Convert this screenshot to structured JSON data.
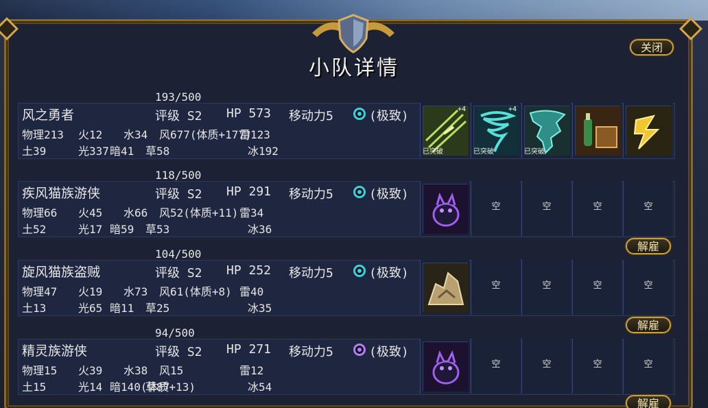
{
  "title": "小队详情",
  "close_label": "关闭",
  "release_label": "解雇",
  "empty_label": "空",
  "broken_label": "已突破",
  "plus_label": "+4",
  "colors": {
    "swirl_teal": "#3ed0d6",
    "swirl_purple": "#b37cf0"
  },
  "units": [
    {
      "count": "193/500",
      "name": "风之勇者",
      "rating": "评级 S2",
      "hp": "HP 573",
      "move": "移动力5",
      "level": "(极致)",
      "swirl": "teal",
      "row1": [
        "物理213",
        "火12",
        "水34",
        "风677(体质+177)",
        "雷123"
      ],
      "row2": [
        "土39",
        "光337",
        "暗41",
        "草58",
        "冰192"
      ],
      "slots": [
        {
          "icon": "claw-skill-icon",
          "plus": true,
          "broken": true
        },
        {
          "icon": "tornado-skill-icon",
          "plus": true,
          "broken": true
        },
        {
          "icon": "storm-skill-icon",
          "plus": false,
          "broken": true
        },
        {
          "icon": "potion-chest-icon",
          "plus": false,
          "broken": false
        },
        {
          "icon": "lightning-runner-icon",
          "plus": false,
          "broken": false
        }
      ]
    },
    {
      "count": "118/500",
      "name": "疾风猫族游侠",
      "rating": "评级 S2",
      "hp": "HP 291",
      "move": "移动力5",
      "level": "(极致)",
      "swirl": "teal",
      "row1": [
        "物理66",
        "火45",
        "水66",
        "风52(体质+11)",
        "雷34"
      ],
      "row2": [
        "土52",
        "光17",
        "暗59",
        "草53",
        "冰36"
      ],
      "slots": [
        {
          "icon": "shadow-cat-icon"
        },
        {
          "icon": "empty"
        },
        {
          "icon": "empty"
        },
        {
          "icon": "empty"
        },
        {
          "icon": "empty"
        }
      ]
    },
    {
      "count": "104/500",
      "name": "旋风猫族盗贼",
      "rating": "评级 S2",
      "hp": "HP 252",
      "move": "移动力5",
      "level": "(极致)",
      "swirl": "teal",
      "row1": [
        "物理47",
        "火19",
        "水73",
        "风61(体质+8)",
        "雷40"
      ],
      "row2": [
        "土13",
        "光65",
        "暗11",
        "草25",
        "冰35"
      ],
      "slots": [
        {
          "icon": "rock-pile-icon"
        },
        {
          "icon": "empty"
        },
        {
          "icon": "empty"
        },
        {
          "icon": "empty"
        },
        {
          "icon": "empty"
        }
      ]
    },
    {
      "count": "94/500",
      "name": "精灵族游侠",
      "rating": "评级 S2",
      "hp": "HP 271",
      "move": "移动力5",
      "level": "(极致)",
      "swirl": "purple",
      "row1": [
        "物理15",
        "火39",
        "水38",
        "风15",
        "雷12"
      ],
      "row2": [
        "土15",
        "光14",
        "暗140(体质+13)",
        "草87",
        "冰54"
      ],
      "slots": [
        {
          "icon": "shadow-cat-icon"
        },
        {
          "icon": "empty"
        },
        {
          "icon": "empty"
        },
        {
          "icon": "empty"
        },
        {
          "icon": "empty"
        }
      ]
    }
  ]
}
